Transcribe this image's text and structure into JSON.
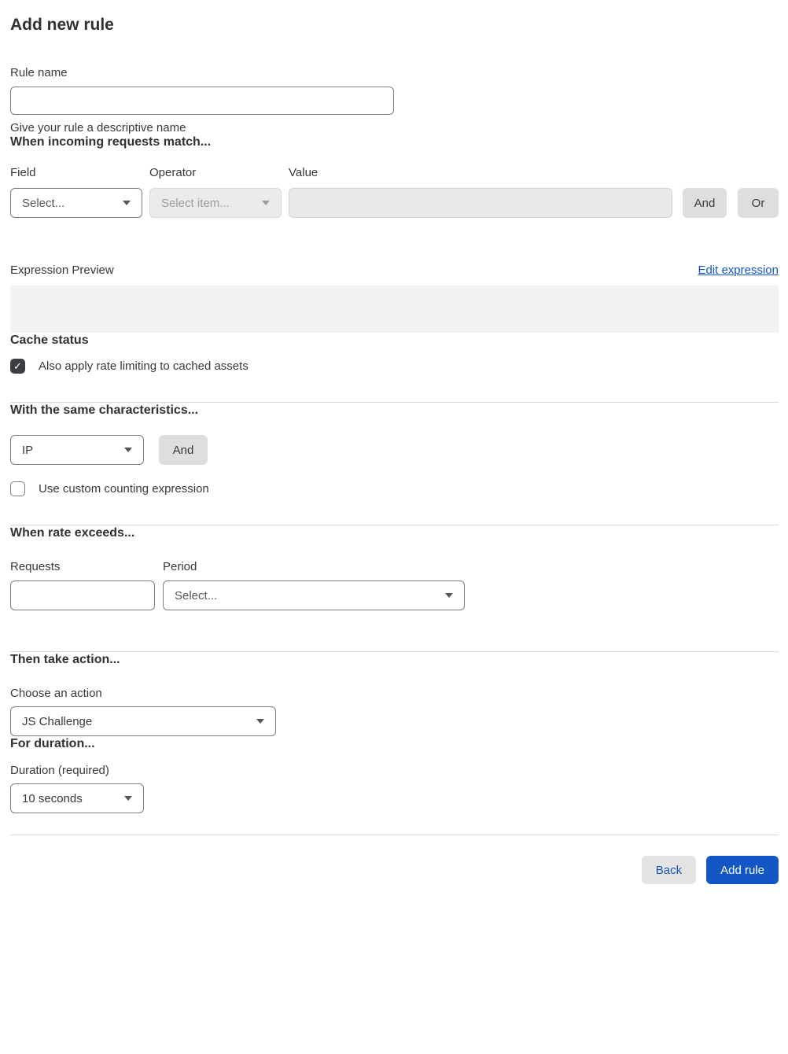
{
  "page": {
    "title": "Add new rule"
  },
  "icons": {
    "check_glyph": "✓"
  },
  "colors": {
    "accent_blue": "#1356c6",
    "checkbox_checked": "#3b3e40",
    "disabled_bg": "#ebebeb",
    "divider": "#d9d9d9",
    "preview_bg": "#f2f2f2"
  },
  "rule_name": {
    "label": "Rule name",
    "value": "",
    "helper": "Give your rule a descriptive name"
  },
  "match": {
    "heading": "When incoming requests match...",
    "field": {
      "label": "Field",
      "selected": "Select..."
    },
    "operator": {
      "label": "Operator",
      "selected": "Select item..."
    },
    "value": {
      "label": "Value",
      "value": ""
    },
    "and_label": "And",
    "or_label": "Or"
  },
  "expression": {
    "label": "Expression Preview",
    "edit_link": "Edit expression",
    "preview": ""
  },
  "cache": {
    "heading": "Cache status",
    "checkbox_label": "Also apply rate limiting to cached assets",
    "checked": true
  },
  "characteristics": {
    "heading": "With the same characteristics...",
    "selected": "IP",
    "and_label": "And",
    "checkbox_label": "Use custom counting expression",
    "checked": false
  },
  "rate": {
    "heading": "When rate exceeds...",
    "requests_label": "Requests",
    "requests_value": "",
    "period_label": "Period",
    "period_selected": "Select..."
  },
  "action": {
    "heading": "Then take action...",
    "label": "Choose an action",
    "selected": "JS Challenge"
  },
  "duration": {
    "heading": "For duration...",
    "label": "Duration (required)",
    "selected": "10 seconds"
  },
  "footer": {
    "back_label": "Back",
    "add_label": "Add rule"
  }
}
